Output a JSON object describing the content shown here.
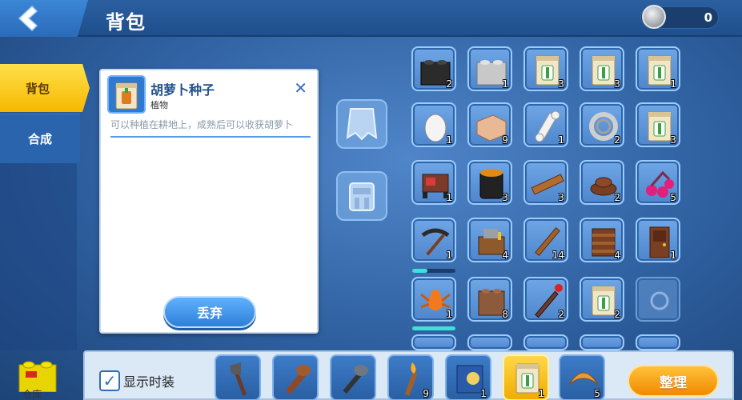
{
  "header": {
    "title": "背包",
    "coins": "0"
  },
  "tabs": [
    {
      "label": "背包",
      "active": true
    },
    {
      "label": "合成",
      "active": false
    }
  ],
  "detail": {
    "name": "胡萝卜种子",
    "category": "植物",
    "description": "可以种植在耕地上，成熟后可以收获胡萝卜",
    "discard_label": "丢弃"
  },
  "grid": {
    "rows": [
      [
        {
          "icon": "black-brick-icon",
          "count": "2"
        },
        {
          "icon": "gray-brick-icon",
          "count": "1"
        },
        {
          "icon": "seed-bag-icon",
          "count": "3"
        },
        {
          "icon": "seed-bag-icon",
          "count": "3"
        },
        {
          "icon": "seed-bag-icon",
          "count": "1"
        }
      ],
      [
        {
          "icon": "egg-icon",
          "count": "1"
        },
        {
          "icon": "meat-brick-icon",
          "count": "9"
        },
        {
          "icon": "bone-icon",
          "count": "1"
        },
        {
          "icon": "rope-icon",
          "count": "2"
        },
        {
          "icon": "seed-bag-icon",
          "count": "3"
        }
      ],
      [
        {
          "icon": "workbench-icon",
          "count": "1"
        },
        {
          "icon": "barrel-icon",
          "count": "3"
        },
        {
          "icon": "plank-icon",
          "count": "3"
        },
        {
          "icon": "wood-round-icon",
          "count": "2"
        },
        {
          "icon": "cherry-icon",
          "count": "5"
        }
      ],
      [
        {
          "icon": "pickaxe-icon",
          "count": "1"
        },
        {
          "icon": "crafting-table-icon",
          "count": "4"
        },
        {
          "icon": "stick-icon",
          "count": "14"
        },
        {
          "icon": "fence-icon",
          "count": "4"
        },
        {
          "icon": "door-icon",
          "count": "1"
        }
      ],
      [
        {
          "icon": "spider-icon",
          "count": "1"
        },
        {
          "icon": "crate-icon",
          "count": "8"
        },
        {
          "icon": "torch-stick-icon",
          "count": "2"
        },
        {
          "icon": "seed-bag-icon",
          "count": "2"
        },
        {
          "icon": "empty-slot-icon",
          "count": ""
        }
      ]
    ],
    "durability": [
      0.35,
      1.0
    ]
  },
  "bottom": {
    "show_equip_label": "显示时装",
    "show_equip_checked": true,
    "hotbar": [
      {
        "icon": "axe-icon",
        "count": ""
      },
      {
        "icon": "club-icon",
        "count": ""
      },
      {
        "icon": "stone-club-icon",
        "count": ""
      },
      {
        "icon": "torch-icon",
        "count": "9"
      },
      {
        "icon": "map-icon",
        "count": "1"
      },
      {
        "icon": "seed-bag-icon",
        "count": "1",
        "selected": true
      },
      {
        "icon": "croissant-icon",
        "count": "5"
      }
    ],
    "sort_label": "整理",
    "storage_label": "仓库"
  },
  "colors": {
    "accent_yellow": "#f6b800",
    "panel_blue": "#2f7ad0",
    "background": "#2e5f9f"
  }
}
